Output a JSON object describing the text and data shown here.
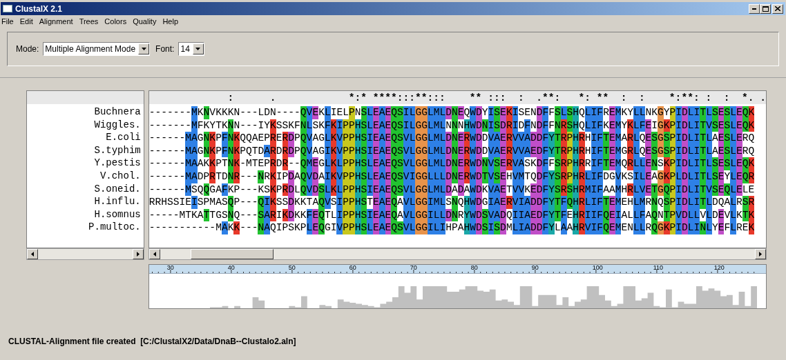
{
  "window": {
    "title": "ClustalX 2.1"
  },
  "menu": [
    "File",
    "Edit",
    "Alignment",
    "Trees",
    "Colors",
    "Quality",
    "Help"
  ],
  "toolbar": {
    "mode_label": "Mode:",
    "mode_value": "Multiple Alignment Mode",
    "font_label": "Font:",
    "font_value": "14"
  },
  "alignment": {
    "consensus": "             :      .            *:* ****:::**:::    ** :::  :  .**:   *: **  :  :    *:**: :  :  *. .",
    "sequences": [
      {
        "name": "Buchnera",
        "residues": "-------MKNVKKKN---LDN----QVEKLIELPNSLEAEQSILGGLMLDNEQWDYISEKISENDFFSLSHQLIFREMKYLLNKGYPIDLITLSESLEQK"
      },
      {
        "name": "Wiggles.",
        "residues": "-------MFKYTKNN---IYKSSKFNLSKFKIPPHSLEAEQSILGGLMLNNNHWDNISDRIDFNDFFNRSHQLIFKEMYKLFEIGKPIDLITVSESLEQK"
      },
      {
        "name": "E.coli",
        "residues": "------MAGNKPFNKQQAEPRERDPQVAGLKVPPHSIEAEQSVLGGLMLDNERWDDVAERVVADDFYTRPHRHIFTEMARLQESGSPIDLITLAESLERQ"
      },
      {
        "name": "S.typhim",
        "residues": "------MAGNKPFNKPQTDARDRDPQVAGIKVPPHSIEAEQSVLGGLMLDNERWDDVAERVVAEDFYTRPHRHIFTEMGRLQESGSPIDLITLAESLERQ"
      },
      {
        "name": "Y.pestis",
        "residues": "------MAAKKPTNK-MTEPRDR--QMEGLKLPPHSLEAEQSVLGGLMLDNERWDNVSERVASKDFFSRPHRRIFTEMQRLLENSKPIDLITLSESLEQK"
      },
      {
        "name": "V.chol.",
        "residues": "------MADPRTDNR---NRKIPDAQVDAIKVPPHSLEAEQSVIGGLLLDNERWDTVSEHVMTQDFYSRPHRLIFDGVKSILEAGKPLDLITLSEYLEQR"
      },
      {
        "name": "S.oneid.",
        "residues": "------MSQQGAFKP---KSKPRDLQVDSLKLPPHSIEAEQSVLGGLMLDADAWDKVAETVVKEDFYSRSHRMIFAAMHRLVETGQPIDLITVSEQLELE"
      },
      {
        "name": "H.influ.",
        "residues": "RRHSSIEISPMASQP---QIKSSDKKTAQVSIPPHSTEAEQAVLGGIMLSNQHWDGIAERVIADDFYTFQHRLIFTEMEHLMRNQSPIDLITLDQALRSR"
      },
      {
        "name": "H.somnus",
        "residues": "-----MTKATTGSNQ---SARIKDKKFEQTLIPPHSIEAEQAVLGGILLDNRYWDSVADQIIAEDFYTFEHRIIFQEIALLFAQNTPVDLLVLDEVLKTK"
      },
      {
        "name": "P.multoc.",
        "residues": "-----------MAKK---NAQIPSKPLEQGIVPPHSLEAEQSVLGGILIHPAHWDSISDMLIADDFYLAAHRVIFQEMENLLRQGKPIDLINLYEFLREK"
      }
    ],
    "ruler": [
      "30",
      "40",
      "50",
      "60",
      "70",
      "80",
      "90",
      "100",
      "110",
      "120"
    ]
  },
  "status_bar": "CLUSTAL-Alignment file created  [C:/ClustalX2/Data/DnaB--Clustalo2.aln]"
}
